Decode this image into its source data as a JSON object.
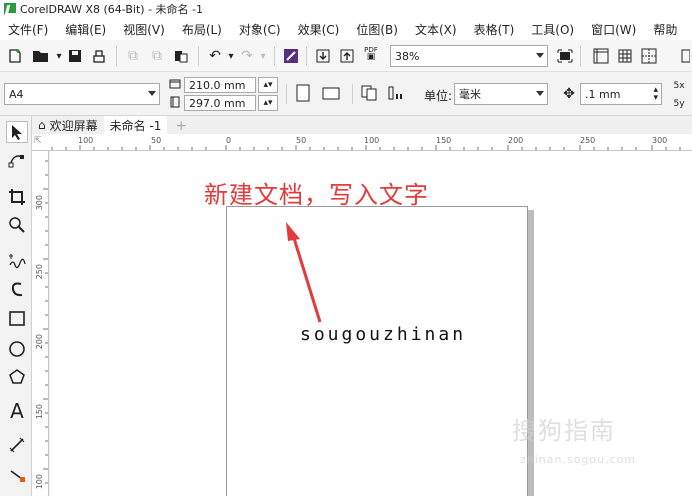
{
  "window": {
    "title": "CorelDRAW X8 (64-Bit) - 未命名 -1"
  },
  "menubar": {
    "items": [
      "文件(F)",
      "编辑(E)",
      "视图(V)",
      "布局(L)",
      "对象(C)",
      "效果(C)",
      "位图(B)",
      "文本(X)",
      "表格(T)",
      "工具(O)",
      "窗口(W)",
      "帮助"
    ]
  },
  "toolbar": {
    "zoom": "38%",
    "pdf_label": "PDF",
    "paper_size": "A4",
    "page_width": "210.0 mm",
    "page_height": "297.0 mm",
    "units_label": "单位:",
    "units_value": "毫米",
    "nudge": ".1 mm",
    "scale_x_label": "5x",
    "scale_y_label": "5y"
  },
  "tabs": {
    "welcome": "欢迎屏幕",
    "document": "未命名 -1",
    "add": "+"
  },
  "rulers": {
    "horizontal": [
      "100",
      "50",
      "0",
      "50",
      "100",
      "150",
      "200",
      "250",
      "300"
    ],
    "vertical": [
      "300",
      "250",
      "200",
      "150",
      "100"
    ]
  },
  "canvas": {
    "annotation": "新建文档，写入文字",
    "page_text": "sougouzhinan"
  },
  "watermark": {
    "main": "搜狗指南",
    "sub": "zhinan.sogou.com"
  },
  "colors": {
    "annotation": "#e33b3b",
    "logo": "#2e9a3e"
  }
}
